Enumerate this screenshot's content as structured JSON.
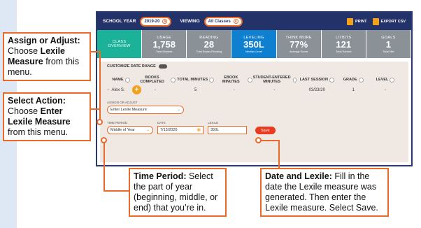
{
  "app": {
    "school_year_label": "SCHOOL YEAR",
    "school_year_value": "2019-20",
    "viewing_label": "VIEWING",
    "viewing_value": "All Classes",
    "print_label": "PRINT",
    "export_label": "EXPORT CSV"
  },
  "cards": [
    {
      "title": "CLASS\nOVERVIEW",
      "value": "",
      "sub": "",
      "color": "#1cb29a"
    },
    {
      "title": "USAGE",
      "value": "1,758",
      "sub": "Total Minutes",
      "color": "#8a9297"
    },
    {
      "title": "READING",
      "value": "28",
      "sub": "Total Books Reading",
      "color": "#8a9297"
    },
    {
      "title": "LEVELING",
      "value": "350L",
      "sub": "Median Level",
      "color": "#0f7fcf"
    },
    {
      "title": "THINK MORE",
      "value": "77%",
      "sub": "Average Score",
      "color": "#8a9297"
    },
    {
      "title": "LITBITS",
      "value": "121",
      "sub": "Total Earned",
      "color": "#8a9297"
    },
    {
      "title": "GOALS",
      "value": "1",
      "sub": "Total Met",
      "color": "#8a9297"
    }
  ],
  "panel": {
    "range_label": "CUSTOMIZE DATE RANGE",
    "headers": [
      "NAME",
      "BOOKS COMPLETED",
      "TOTAL MINUTES",
      "EBOOK MINUTES",
      "STUDENT-ENTERED MINUTES",
      "LAST SESSION",
      "GRADE",
      "LEVEL"
    ],
    "row": {
      "name": "Alex S.",
      "books": "-",
      "total": "5",
      "ebook": "-",
      "student": "-",
      "last": "03/23/20",
      "grade": "1",
      "level": "-"
    },
    "assign_label": "ASSIGN OR ADJUST",
    "assign_value": "Enter Lexile Measure",
    "time_label": "TIME PERIOD",
    "time_value": "Middle of Year",
    "date_label": "DATE",
    "date_value": "7/13/2020",
    "lexile_label": "LEXILE",
    "lexile_value": "350L",
    "save_label": "Save"
  },
  "callouts": {
    "c1_bold": "Assign or Adjust:",
    "c1_text": " Choose ",
    "c1_bold2": "Lexile Measure",
    "c1_text2": " from this menu.",
    "c2_bold": "Select Action:",
    "c2_text": " Choose ",
    "c2_bold2": "Enter Lexile Measure",
    "c2_text2": " from this menu.",
    "c3_bold": "Time Period:",
    "c3_text": " Select the part of year (beginning, middle, or end) that you’re in.",
    "c4_bold": "Date and Lexile:",
    "c4_text": " Fill in the date the Lexile measure was generated. Then enter the Lexile measure. Select Save."
  }
}
